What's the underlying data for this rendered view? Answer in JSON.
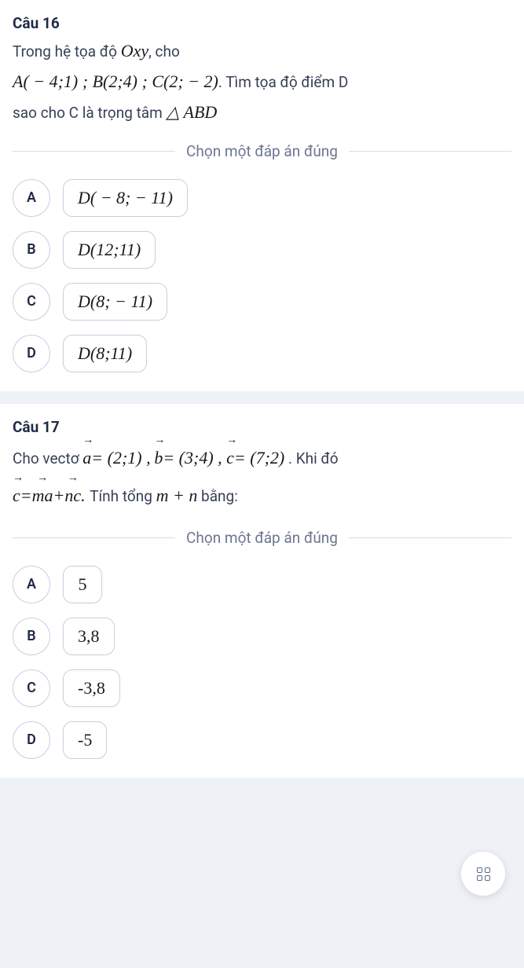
{
  "q16": {
    "title": "Câu 16",
    "line1_pre": "Trong hệ tọa độ ",
    "line1_oxy": "Oxy",
    "line1_post": ", cho",
    "math_main": "A( − 4;1) ; B(2;4) ; C(2; − 2)",
    "line2_post": ". Tìm tọa độ điểm D",
    "line3_pre": "sao cho C là trọng tâm ",
    "line3_tri": "△ ABD",
    "prompt": "Chọn một đáp án đúng",
    "options": [
      {
        "letter": "A",
        "value": "D( − 8; − 11)"
      },
      {
        "letter": "B",
        "value": "D(12;11)"
      },
      {
        "letter": "C",
        "value": "D(8; − 11)"
      },
      {
        "letter": "D",
        "value": "D(8;11)"
      }
    ]
  },
  "q17": {
    "title": "Câu 17",
    "pre1": "Cho vectơ ",
    "a_eq": "= (2;1) ,",
    "b_eq": "= (3;4) , ",
    "c_eq": "= (7;2)",
    "post1": ". Khi đó",
    "line2_mid": " Tính tổng ",
    "mn": "m + n",
    "line2_end": " bằng:",
    "prompt": "Chọn một đáp án đúng",
    "options": [
      {
        "letter": "A",
        "value": "5"
      },
      {
        "letter": "B",
        "value": "3,8"
      },
      {
        "letter": "C",
        "value": "-3,8"
      },
      {
        "letter": "D",
        "value": "-5"
      }
    ]
  },
  "vec_labels": {
    "a": "a",
    "b": "b",
    "c": "c",
    "ma": "ma",
    "nc": "nc"
  }
}
